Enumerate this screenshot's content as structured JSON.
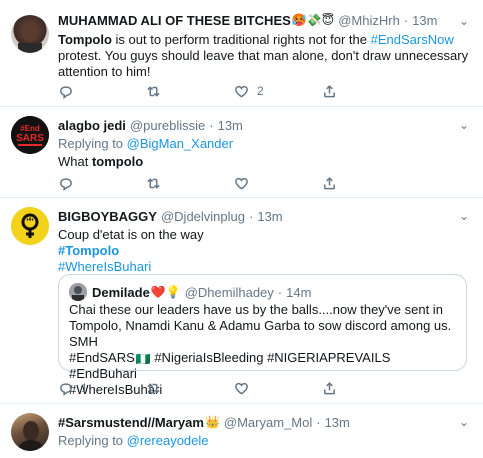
{
  "tweets": [
    {
      "name": "MUHAMMAD ALI OF THESE BITCHES",
      "name_emojis": "🥵💸😇",
      "handle": "@MhizHrh",
      "dot": "·",
      "time": "13m",
      "text_prefix": "Tompolo",
      "text_middle": " is out to perform traditional rights not for the ",
      "hashtag": "#EndSarsNow",
      "text_suffix": " protest. You guys should leave that man alone, don't draw unnecessary attention to him!",
      "reply_count": "",
      "retweet_count": "",
      "like_count": "2"
    },
    {
      "name": "alagbo jedi",
      "handle": "@pureblissie",
      "dot": "·",
      "time": "13m",
      "replying_label": "Replying to ",
      "replying_handle": "@BigMan_Xander",
      "text_prefix": "What ",
      "text_bold": "tompolo",
      "avatar_text_top": "#End",
      "avatar_text_main": "SARS",
      "reply_count": "",
      "retweet_count": "",
      "like_count": ""
    },
    {
      "name": "BIGBOYBAGGY",
      "handle": "@Djdelvinplug",
      "dot": "·",
      "time": "13m",
      "line1": "Coup d'etat is on the way",
      "line2": "#Tompolo",
      "line3": "#WhereIsBuhari",
      "quote": {
        "name": "Demilade",
        "name_emojis": "❤️💡",
        "handle": "@Dhemilhadey",
        "dot": "·",
        "time": "14m",
        "text1": "Chai these our leaders have us by the balls....now they've sent in Tompolo, Nnamdi Kanu & Adamu Garba to sow discord among us. SMH",
        "text2_a": "#EndSARS",
        "text2_emoji": "🇳🇬",
        "text2_b": " #NigeriaIsBleeding #NIGERIAPREVAILS #EndBuhari",
        "text3": "#WhereIsBuhari"
      },
      "reply_count": "1",
      "retweet_count": "",
      "like_count": ""
    },
    {
      "name": "#Sarsmustend//Maryam",
      "name_emojis": "👑",
      "handle": "@Maryam_Mol",
      "dot": "·",
      "time": "13m",
      "replying_label": "Replying to ",
      "replying_handle": "@rereayodele"
    }
  ],
  "icons": [
    "chevron-down-icon",
    "reply-icon",
    "retweet-icon",
    "like-icon",
    "share-icon"
  ],
  "colors": {
    "link": "#1b95e0",
    "muted": "#657786",
    "border": "#e6ecf0",
    "text": "#14171a"
  }
}
